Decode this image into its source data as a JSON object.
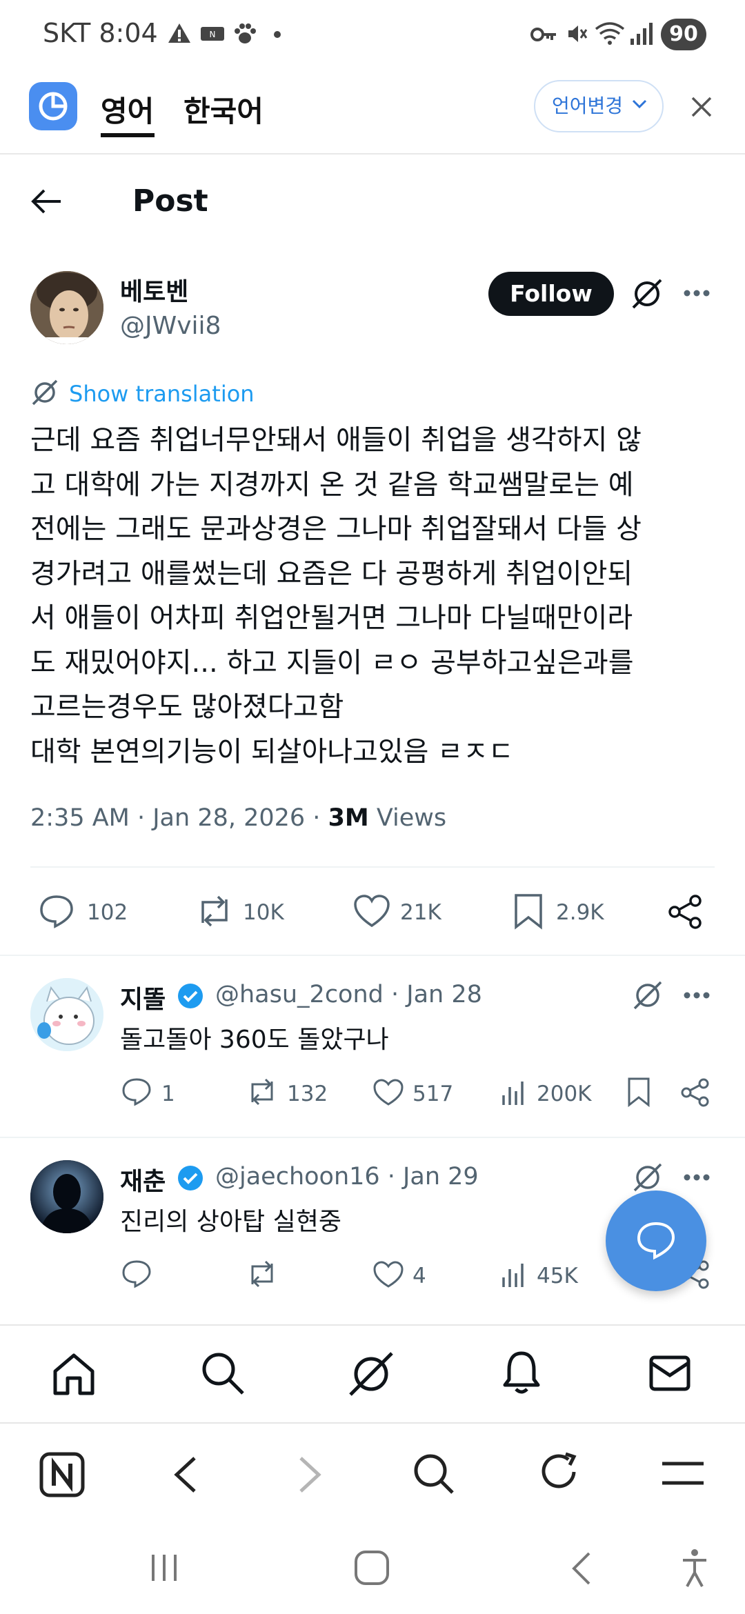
{
  "status_bar": {
    "carrier_time": "SKT 8:04",
    "battery": "90"
  },
  "translator": {
    "tab_source": "영어",
    "tab_target": "한국어",
    "change_language": "언어변경"
  },
  "header": {
    "title": "Post"
  },
  "post": {
    "author_name": "베토벤",
    "author_handle": "@JWvii8",
    "follow_label": "Follow",
    "show_translation": "Show translation",
    "body": "근데 요즘 취업너무안돼서 애들이 취업을 생각하지 않\n고 대학에 가는 지경까지 온 것 같음 학교쌤말로는 예\n전에는 그래도 문과상경은 그나마 취업잘돼서 다들 상\n경가려고 애를썼는데 요즘은 다 공평하게 취업이안되\n서 애들이 어차피 취업안될거면 그나마 다닐때만이라\n도 재밌어야지... 하고 지들이 ㄹㅇ 공부하고싶은과를\n고르는경우도 많아졌다고함\n대학 본연의기능이 되살아나고있음 ㄹㅈㄷ",
    "timestamp": "2:35 AM · Jan 28, 2026 · ",
    "views_count": "3M",
    "views_label": " Views",
    "stats": {
      "replies": "102",
      "reposts": "10K",
      "likes": "21K",
      "bookmarks": "2.9K"
    }
  },
  "replies": [
    {
      "name": "지똘",
      "handle": "@hasu_2cond · Jan 28",
      "text": "돌고돌아 360도 돌았구나",
      "replies": "1",
      "reposts": "132",
      "likes": "517",
      "views": "200K"
    },
    {
      "name": "재춘",
      "handle": "@jaechoon16 · Jan 29",
      "text": "진리의 상아탑 실현중",
      "replies": "",
      "reposts": "",
      "likes": "4",
      "views": "45K"
    }
  ],
  "colors": {
    "accent": "#1d9bf0",
    "fab": "#4a90e2",
    "translator_logo": "#4a8ef0"
  }
}
